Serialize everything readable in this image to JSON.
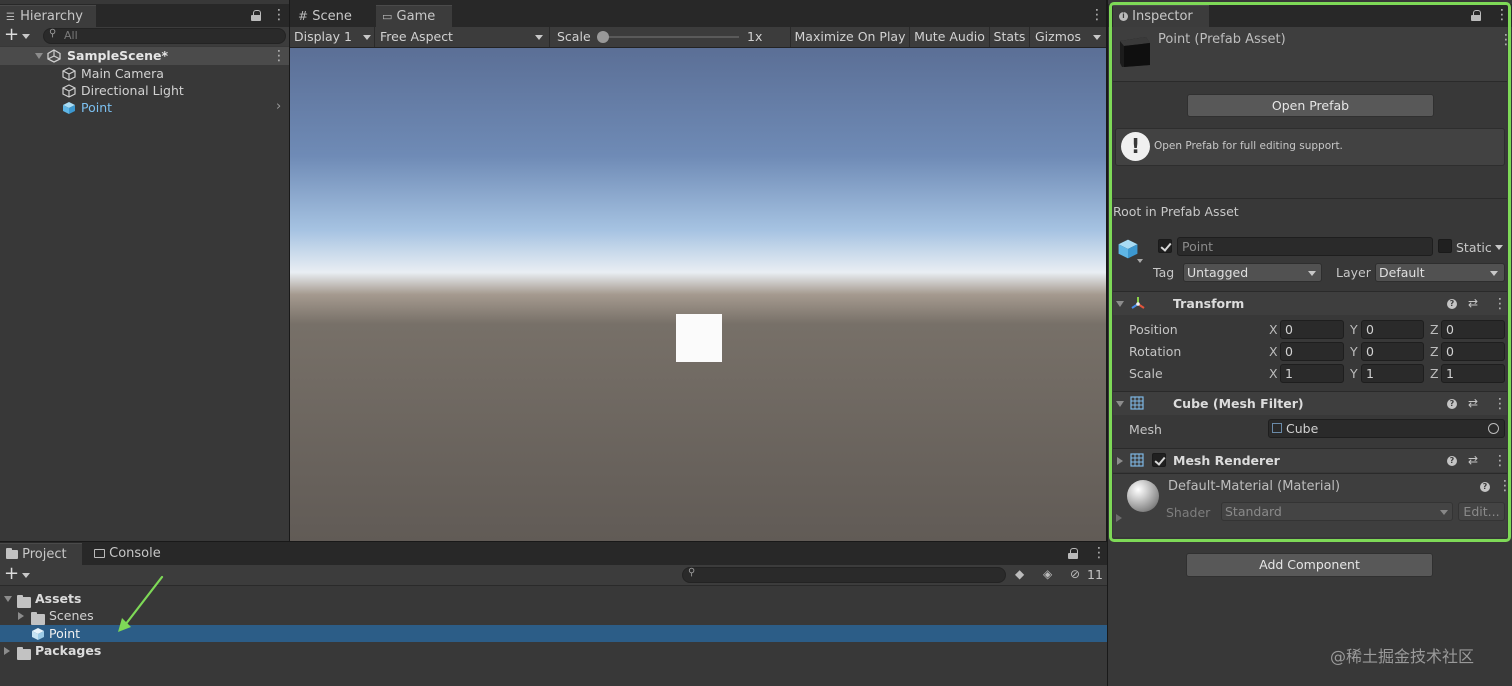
{
  "hierarchy": {
    "tab": "Hierarchy",
    "search_placeholder": "All",
    "scene": "SampleScene*",
    "items": [
      "Main Camera",
      "Directional Light",
      "Point"
    ]
  },
  "game": {
    "tabs": {
      "scene": "Scene",
      "game": "Game"
    },
    "display": "Display 1",
    "aspect": "Free Aspect",
    "scale_label": "Scale",
    "scale_value": "1x",
    "buttons": {
      "maximize": "Maximize On Play",
      "mute": "Mute Audio",
      "stats": "Stats",
      "gizmos": "Gizmos"
    }
  },
  "project": {
    "tabs": {
      "project": "Project",
      "console": "Console"
    },
    "hidden_count": "11",
    "tree": {
      "assets": "Assets",
      "scenes": "Scenes",
      "point": "Point",
      "packages": "Packages"
    }
  },
  "inspector": {
    "tab": "Inspector",
    "asset_title": "Point (Prefab Asset)",
    "open_prefab": "Open Prefab",
    "info_message": "Open Prefab for full editing support.",
    "root_label": "Root in Prefab Asset",
    "object_name": "Point",
    "static_label": "Static",
    "tag_label": "Tag",
    "tag_value": "Untagged",
    "layer_label": "Layer",
    "layer_value": "Default",
    "transform": {
      "title": "Transform",
      "rows": [
        {
          "label": "Position",
          "x": "0",
          "y": "0",
          "z": "0"
        },
        {
          "label": "Rotation",
          "x": "0",
          "y": "0",
          "z": "0"
        },
        {
          "label": "Scale",
          "x": "1",
          "y": "1",
          "z": "1"
        }
      ],
      "axes": {
        "x": "X",
        "y": "Y",
        "z": "Z"
      }
    },
    "mesh_filter": {
      "title": "Cube (Mesh Filter)",
      "mesh_label": "Mesh",
      "mesh_value": "Cube"
    },
    "mesh_renderer": {
      "title": "Mesh Renderer"
    },
    "material": {
      "name": "Default-Material (Material)",
      "shader_label": "Shader",
      "shader_value": "Standard",
      "edit": "Edit..."
    },
    "add_component": "Add Component",
    "highlight_color": "#7ed957"
  },
  "watermark": "@稀土掘金技术社区"
}
